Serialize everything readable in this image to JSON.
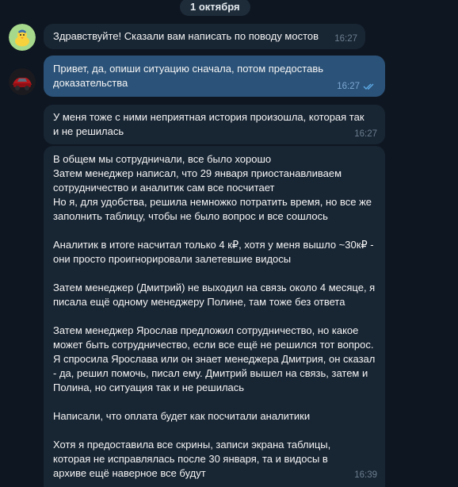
{
  "date_separator": "1 октября",
  "messages": [
    {
      "id": "m1",
      "direction": "incoming",
      "text": "Здравствуйте! Сказали вам написать по поводу мостов",
      "time": "16:27"
    },
    {
      "id": "m2",
      "direction": "outgoing",
      "text": "Привет, да, опиши ситуацию сначала, потом предоставь доказательства",
      "time": "16:27",
      "status": "read"
    },
    {
      "id": "m3",
      "direction": "incoming",
      "text": "У меня тоже с ними неприятная история произошла, которая так и не решилась",
      "time": "16:27"
    },
    {
      "id": "m4",
      "direction": "incoming",
      "paragraphs": [
        "В общем мы сотрудничали, все было хорошо\nЗатем менеджер написал, что 29 января приостанавливаем сотрудничество и аналитик сам все посчитает\nНо я, для удобства, решила немножко потратить время, но все же заполнить таблицу, чтобы не было вопрос и все сошлось",
        "Аналитик в итоге насчитал только 4 к₽, хотя у меня вышло ~30к₽ - они просто проигнорировали залетевшие видосы",
        "Затем менеджер (Дмитрий) не выходил на связь около 4 месяце, я писала ещё одному менеджеру Полине, там тоже без ответа",
        "Затем менеджер Ярослав предложил сотрудничество, но какое может быть сотрудничество, если все ещё не решился тот вопрос. Я  спросила Ярослава или он знает менеджера Дмитрия, он сказал - да, решил помочь, писал ему. Дмитрий вышел на связь, затем и Полина, но ситуация так и не решилась",
        "Написали, что оплата будет как посчитали аналитики",
        "Хотя я предоставила все скрины, записи экрана таблицы, которая не исправлялась после 30 января, та и видосы в архиве ещё наверное все будут"
      ],
      "time": "16:39"
    }
  ],
  "colors": {
    "background": "#0e1621",
    "incoming_bubble": "#182533",
    "outgoing_bubble": "#2b5278",
    "read_ticks": "#5ca9e6"
  },
  "icons": {
    "contact_avatar": "duck-avatar-icon",
    "own_avatar": "red-car-avatar-icon",
    "read_status": "double-check-icon"
  }
}
